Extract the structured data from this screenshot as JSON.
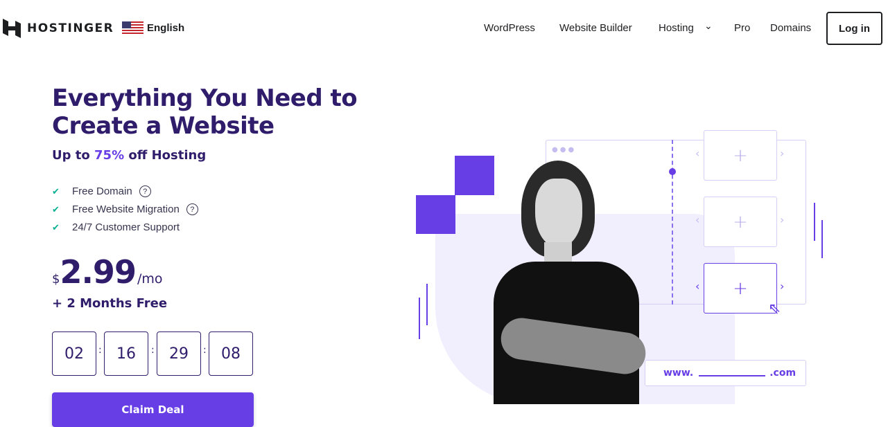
{
  "header": {
    "logo": "HOSTINGER",
    "language": "English",
    "nav": [
      "WordPress",
      "Website Builder",
      "Hosting",
      "Pro",
      "Domains"
    ],
    "login": "Log in"
  },
  "hero": {
    "title_line1": "Everything You Need to",
    "title_line2": "Create a Website",
    "subtitle_pre": "Up to ",
    "subtitle_pct": "75%",
    "subtitle_post": " off Hosting",
    "features": [
      "Free Domain",
      "Free Website Migration",
      "24/7 Customer Support"
    ],
    "currency": "$",
    "price": "2.99",
    "period": "/mo",
    "bonus": "+ 2 Months Free",
    "countdown": [
      "02",
      "16",
      "29",
      "08"
    ],
    "cta": "Claim Deal"
  },
  "illustration": {
    "url_prefix": "www.",
    "url_suffix": ".com"
  },
  "colors": {
    "brand": "#673de6",
    "heading": "#2f1c6a",
    "check": "#00b090"
  }
}
